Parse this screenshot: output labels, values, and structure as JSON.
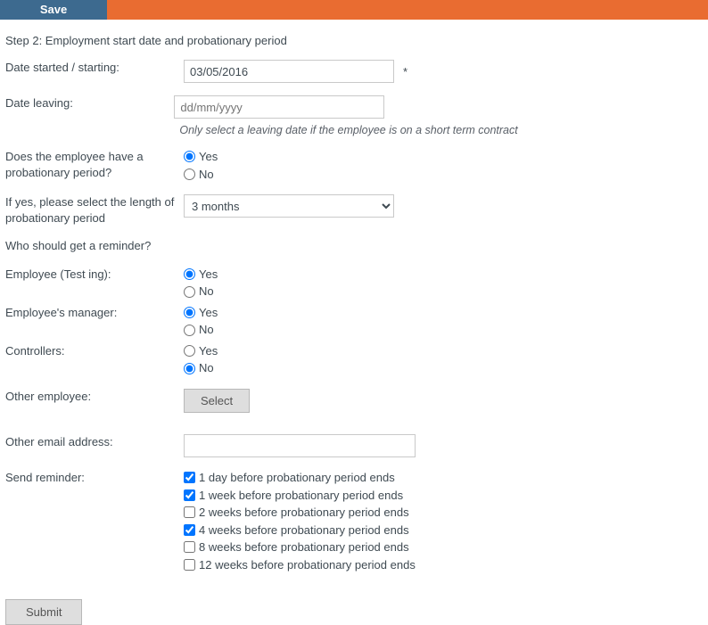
{
  "header": {
    "save_label": "Save"
  },
  "step_title": "Step 2: Employment start date and probationary period",
  "labels": {
    "date_started": "Date started / starting:",
    "date_leaving": "Date leaving:",
    "probation_q": "Does the employee have a probationary period?",
    "probation_length": "If yes, please select the length of probationary period",
    "reminder_q": "Who should get a reminder?",
    "emp_test": "Employee (Test ing):",
    "emp_manager": "Employee's manager:",
    "controllers": "Controllers:",
    "other_employee": "Other employee:",
    "other_email": "Other email address:",
    "send_reminder": "Send reminder:"
  },
  "fields": {
    "date_started_value": "03/05/2016",
    "date_leaving_placeholder": "dd/mm/yyyy",
    "leaving_hint": "Only select a leaving date if the employee is on a short term contract",
    "probation_length_value": "3 months"
  },
  "radios": {
    "yes": "Yes",
    "no": "No"
  },
  "buttons": {
    "select": "Select",
    "submit": "Submit"
  },
  "reminders": [
    {
      "label": "1 day before probationary period ends",
      "checked": true
    },
    {
      "label": "1 week before probationary period ends",
      "checked": true
    },
    {
      "label": "2 weeks before probationary period ends",
      "checked": false
    },
    {
      "label": "4 weeks before probationary period ends",
      "checked": true
    },
    {
      "label": "8 weeks before probationary period ends",
      "checked": false
    },
    {
      "label": "12 weeks before probationary period ends",
      "checked": false
    }
  ]
}
